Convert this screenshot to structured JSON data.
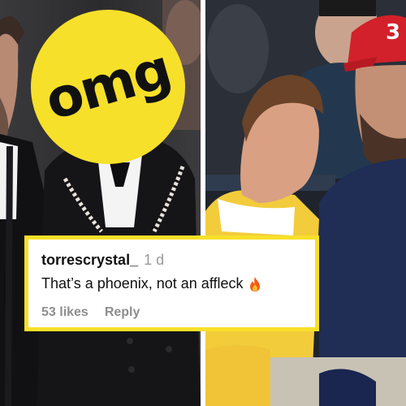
{
  "badge": {
    "text": "omg",
    "color": "#f7e02a"
  },
  "comment": {
    "username": "torrescrystal_",
    "time": "1 d",
    "text": "That’s a phoenix, not an affleck",
    "emoji": "fire-icon",
    "likes": "53 likes",
    "reply": "Reply",
    "border_color": "#f7e02a"
  },
  "photos": {
    "left": "photo-two-men-in-black-tuxedos",
    "right": "photo-man-in-red-cap-and-boy-at-courtside",
    "cap_number": "3"
  }
}
